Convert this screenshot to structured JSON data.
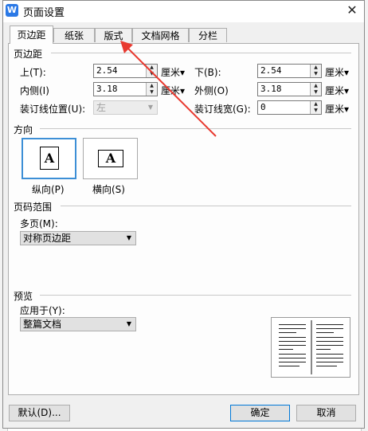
{
  "window": {
    "title": "页面设置",
    "app_icon": "W",
    "close_glyph": "✕"
  },
  "tabs": [
    {
      "label": "页边距",
      "active": true
    },
    {
      "label": "纸张",
      "active": false
    },
    {
      "label": "版式",
      "active": false
    },
    {
      "label": "文档网格",
      "active": false
    },
    {
      "label": "分栏",
      "active": false
    }
  ],
  "margins": {
    "section_title": "页边距",
    "top": {
      "label": "上(T):",
      "value": "2.54",
      "unit": "厘米▾"
    },
    "bottom": {
      "label": "下(B):",
      "value": "2.54",
      "unit": "厘米▾"
    },
    "inner": {
      "label": "内侧(I)",
      "value": "3.18",
      "unit": "厘米▾"
    },
    "outer": {
      "label": "外侧(O)",
      "value": "3.18",
      "unit": "厘米▾"
    },
    "gutter_pos": {
      "label": "装订线位置(U):",
      "value": "左"
    },
    "gutter_width": {
      "label": "装订线宽(G):",
      "value": "0",
      "unit": "厘米▾"
    }
  },
  "orientation": {
    "section_title": "方向",
    "portrait": {
      "label": "纵向(P)",
      "glyph": "A"
    },
    "landscape": {
      "label": "横向(S)",
      "glyph": "A"
    }
  },
  "pages": {
    "section_title": "页码范围",
    "multi_label": "多页(M):",
    "multi_value": "对称页边距"
  },
  "preview": {
    "section_title": "预览",
    "apply_label": "应用于(Y):",
    "apply_value": "整篇文档"
  },
  "buttons": {
    "default": "默认(D)...",
    "ok": "确定",
    "cancel": "取消"
  },
  "colors": {
    "accent": "#0078d7",
    "selection": "#3d8fd6",
    "annotation_arrow": "#e8392f"
  }
}
